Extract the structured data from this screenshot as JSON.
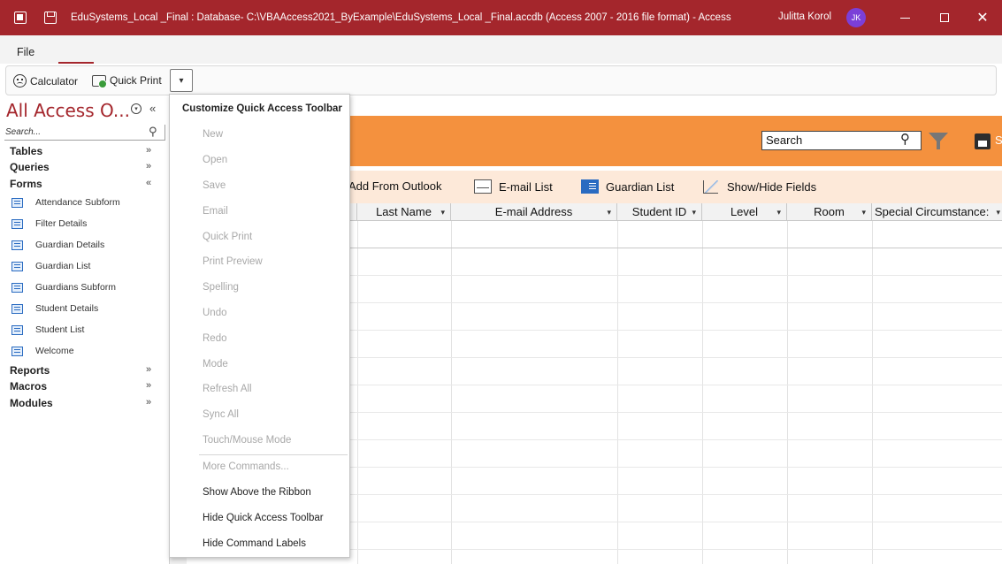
{
  "window": {
    "title": "EduSystems_Local _Final : Database- C:\\VBAAccess2021_ByExample\\EduSystems_Local _Final.accdb (Access 2007 - 2016 file format)  -  Access",
    "user_name": "Julitta Korol",
    "user_initials": "JK",
    "minimize": "—",
    "maximize": "",
    "close": "✕"
  },
  "ribbon": {
    "file_tab": "File"
  },
  "qat": {
    "calculator_label": "Calculator",
    "quick_print_label": "Quick Print",
    "dropdown_glyph": "▾"
  },
  "nav": {
    "title": "All Access O...",
    "collapse_glyph": "«",
    "search_placeholder": "Search...",
    "groups": {
      "tables": "Tables",
      "queries": "Queries",
      "forms": "Forms",
      "reports": "Reports",
      "macros": "Macros",
      "modules": "Modules"
    },
    "forms": [
      "Attendance Subform",
      "Filter Details",
      "Guardian Details",
      "Guardian List",
      "Guardians Subform",
      "Student Details",
      "Student List",
      "Welcome"
    ]
  },
  "qat_menu": {
    "title": "Customize Quick Access Toolbar",
    "items": [
      "New",
      "Open",
      "Save",
      "Email",
      "Quick Print",
      "Print Preview",
      "Spelling",
      "Undo",
      "Redo",
      "Mode",
      "Refresh All",
      "Sync All",
      "Touch/Mouse Mode",
      "More Commands...",
      "Show Above the Ribbon",
      "Hide Quick Access Toolbar",
      "Hide Command Labels"
    ]
  },
  "form": {
    "search_value": "Search",
    "save_partial": "S",
    "commands": {
      "add_from_outlook": "Add From Outlook",
      "email_list": "E-mail List",
      "guardian_list": "Guardian List",
      "show_hide_fields": "Show/Hide Fields"
    },
    "columns": [
      "Last Name",
      "E-mail Address",
      "Student ID",
      "Level",
      "Room",
      "Special Circumstance:"
    ]
  },
  "colors": {
    "title_bar": "#a4262c",
    "form_header": "#f4913e",
    "command_bar": "#fde9d9",
    "avatar": "#7b3fd8"
  }
}
